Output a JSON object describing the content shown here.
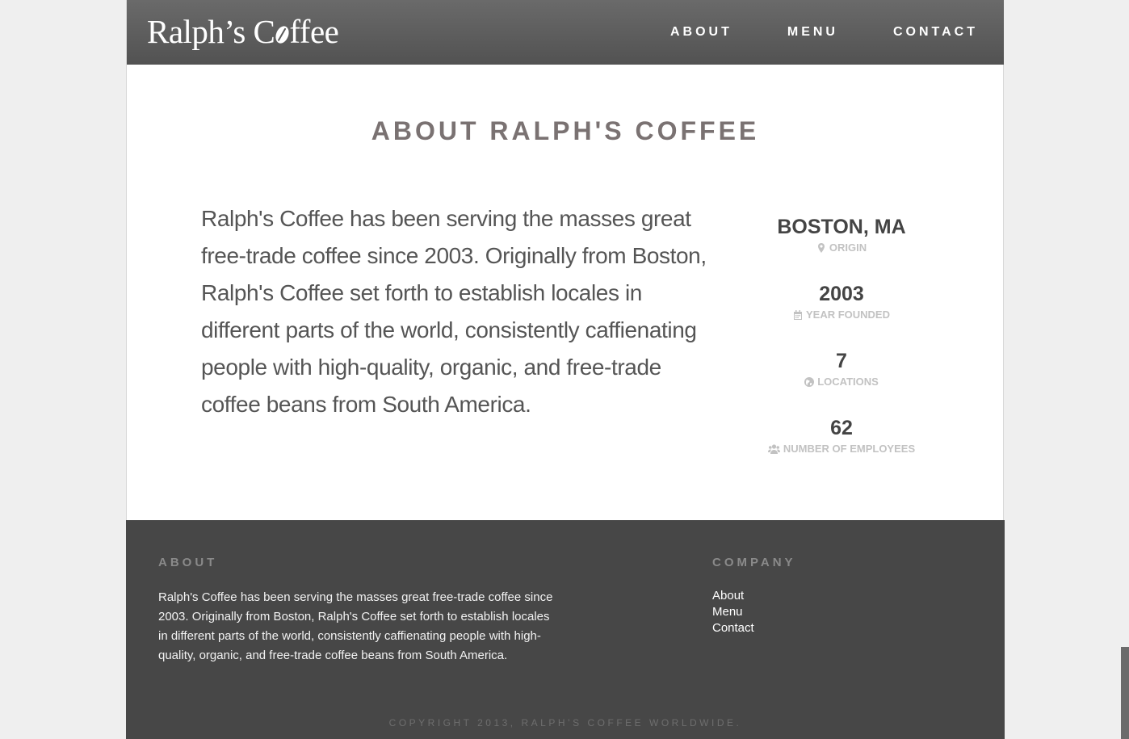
{
  "header": {
    "logo_part1": "Ralph’s C",
    "logo_part2": "ffee",
    "nav": [
      "ABOUT",
      "MENU",
      "CONTACT"
    ]
  },
  "about": {
    "title": "ABOUT RALPH'S COFFEE",
    "lead": "Ralph's Coffee has been serving the masses great free-trade coffee since 2003. Originally from Boston, Ralph's Coffee set forth to establish locales in different parts of the world, consistently caffienating people with high-quality, organic, and free-trade coffee beans from South America.",
    "stats": [
      {
        "value": "BOSTON, MA",
        "label": "ORIGIN",
        "icon": "map-marker-icon"
      },
      {
        "value": "2003",
        "label": "YEAR FOUNDED",
        "icon": "calendar-icon"
      },
      {
        "value": "7",
        "label": "LOCATIONS",
        "icon": "globe-icon"
      },
      {
        "value": "62",
        "label": "NUMBER OF EMPLOYEES",
        "icon": "users-icon"
      }
    ]
  },
  "footer": {
    "about_heading": "ABOUT",
    "about_text": "Ralph's Coffee has been serving the masses great free-trade coffee since 2003. Originally from Boston, Ralph's Coffee set forth to establish locales in different parts of the world, consistently caffienating people with high-quality, organic, and free-trade coffee beans from South America.",
    "company_heading": "COMPANY",
    "links": [
      "About",
      "Menu",
      "Contact"
    ],
    "copyright": "COPYRIGHT 2013, RALPH’S COFFEE WORLDWIDE."
  },
  "colors": {
    "header_bg": "#5e5e5e",
    "footer_bg": "#474747",
    "title": "#7a7272"
  }
}
